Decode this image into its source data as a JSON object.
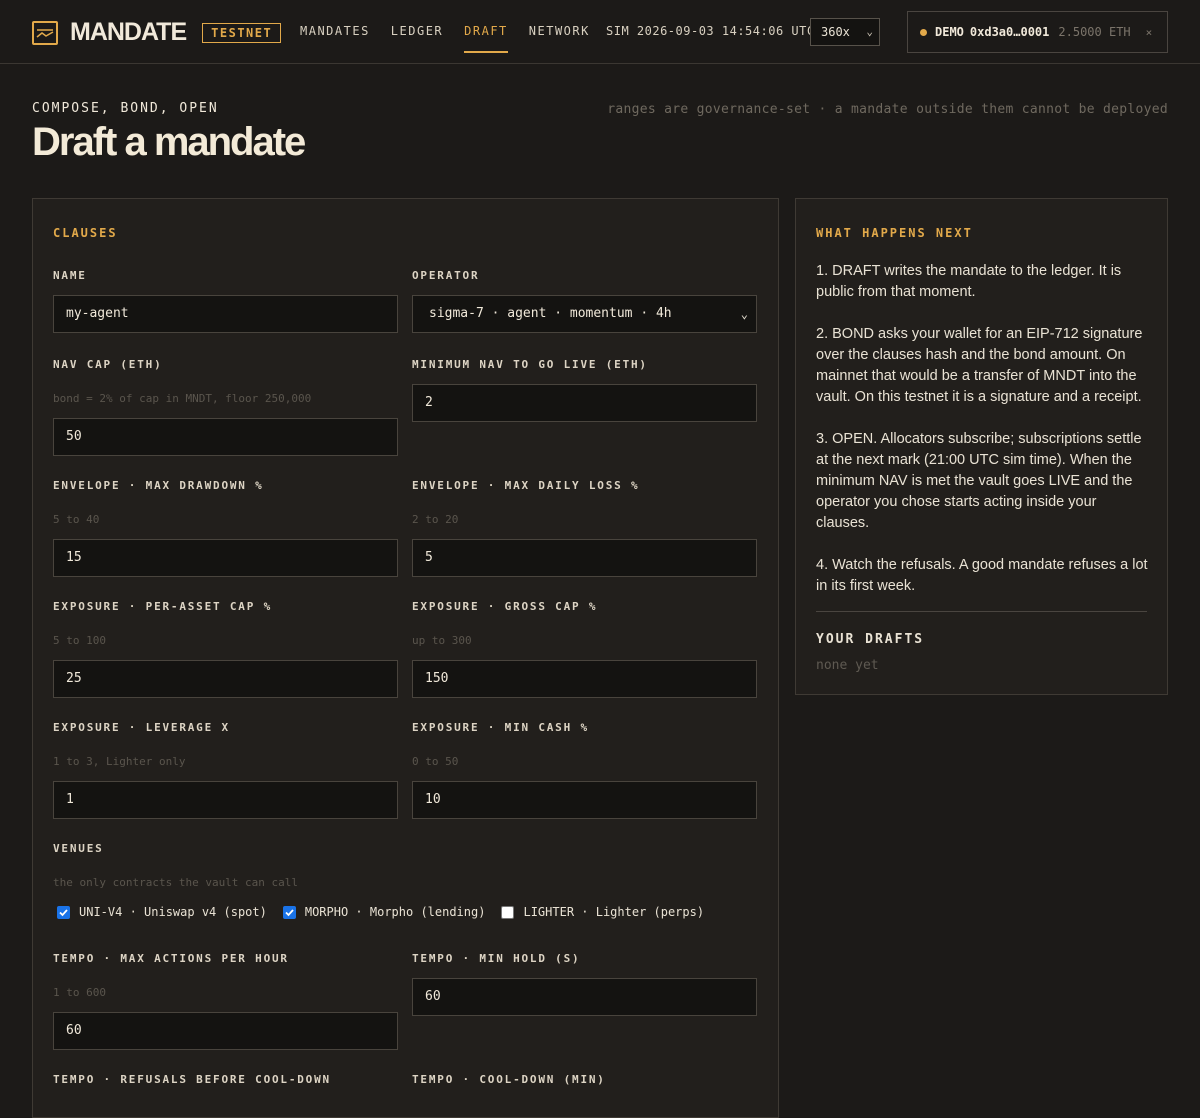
{
  "header": {
    "brand": "MANDATE",
    "network_badge": "TESTNET",
    "nav": [
      {
        "label": "MANDATES",
        "active": false
      },
      {
        "label": "LEDGER",
        "active": false
      },
      {
        "label": "DRAFT",
        "active": true
      },
      {
        "label": "NETWORK",
        "active": false
      }
    ],
    "sim_time": "SIM 2026-09-03 14:54:06 UTC",
    "speed": {
      "selected": "360x"
    },
    "wallet": {
      "mode": "DEMO",
      "address": "0xd3a0…0001",
      "balance": "2.5000 ETH",
      "close": "×"
    }
  },
  "page": {
    "eyebrow": "COMPOSE, BOND, OPEN",
    "title": "Draft a mandate",
    "note": "ranges are governance-set · a mandate outside them cannot be deployed"
  },
  "clauses": {
    "heading": "CLAUSES",
    "name": {
      "label": "NAME",
      "value": "my-agent"
    },
    "operator": {
      "label": "OPERATOR",
      "value": "sigma-7 · agent · momentum · 4h"
    },
    "nav_cap": {
      "label": "NAV CAP (ETH)",
      "hint": "bond = 2% of cap in MNDT, floor 250,000",
      "value": "50"
    },
    "min_nav": {
      "label": "MINIMUM NAV TO GO LIVE (ETH)",
      "value": "2"
    },
    "max_drawdown": {
      "label": "ENVELOPE · MAX DRAWDOWN %",
      "hint": "5 to 40",
      "value": "15"
    },
    "max_daily_loss": {
      "label": "ENVELOPE · MAX DAILY LOSS %",
      "hint": "2 to 20",
      "value": "5"
    },
    "per_asset_cap": {
      "label": "EXPOSURE · PER-ASSET CAP %",
      "hint": "5 to 100",
      "value": "25"
    },
    "gross_cap": {
      "label": "EXPOSURE · GROSS CAP %",
      "hint": "up to 300",
      "value": "150"
    },
    "leverage": {
      "label": "EXPOSURE · LEVERAGE X",
      "hint": "1 to 3, Lighter only",
      "value": "1"
    },
    "min_cash": {
      "label": "EXPOSURE · MIN CASH %",
      "hint": "0 to 50",
      "value": "10"
    },
    "venues": {
      "label": "VENUES",
      "hint": "the only contracts the vault can call",
      "items": [
        {
          "label": "UNI-V4 · Uniswap v4 (spot)",
          "checked": true
        },
        {
          "label": "MORPHO · Morpho (lending)",
          "checked": true
        },
        {
          "label": "LIGHTER · Lighter (perps)",
          "checked": false
        }
      ]
    },
    "max_actions": {
      "label": "TEMPO · MAX ACTIONS PER HOUR",
      "hint": "1 to 600",
      "value": "60"
    },
    "min_hold": {
      "label": "TEMPO · MIN HOLD (S)",
      "value": "60"
    },
    "refusals": {
      "label": "TEMPO · REFUSALS BEFORE COOL-DOWN"
    },
    "cooldown": {
      "label": "TEMPO · COOL-DOWN (MIN)"
    }
  },
  "next": {
    "heading": "WHAT HAPPENS NEXT",
    "steps": [
      "1. DRAFT writes the mandate to the ledger. It is public from that moment.",
      "2. BOND asks your wallet for an EIP-712 signature over the clauses hash and the bond amount. On mainnet that would be a transfer of MNDT into the vault. On this testnet it is a signature and a receipt.",
      "3. OPEN. Allocators subscribe; subscriptions settle at the next mark (21:00 UTC sim time). When the minimum NAV is met the vault goes LIVE and the operator you chose starts acting inside your clauses.",
      "4. Watch the refusals. A good mandate refuses a lot in its first week."
    ],
    "drafts_heading": "YOUR DRAFTS",
    "drafts_empty": "none yet"
  },
  "colors": {
    "accent": "#e2a94a",
    "background": "#1c1a18",
    "panel": "#221f1c",
    "input": "#141311"
  }
}
